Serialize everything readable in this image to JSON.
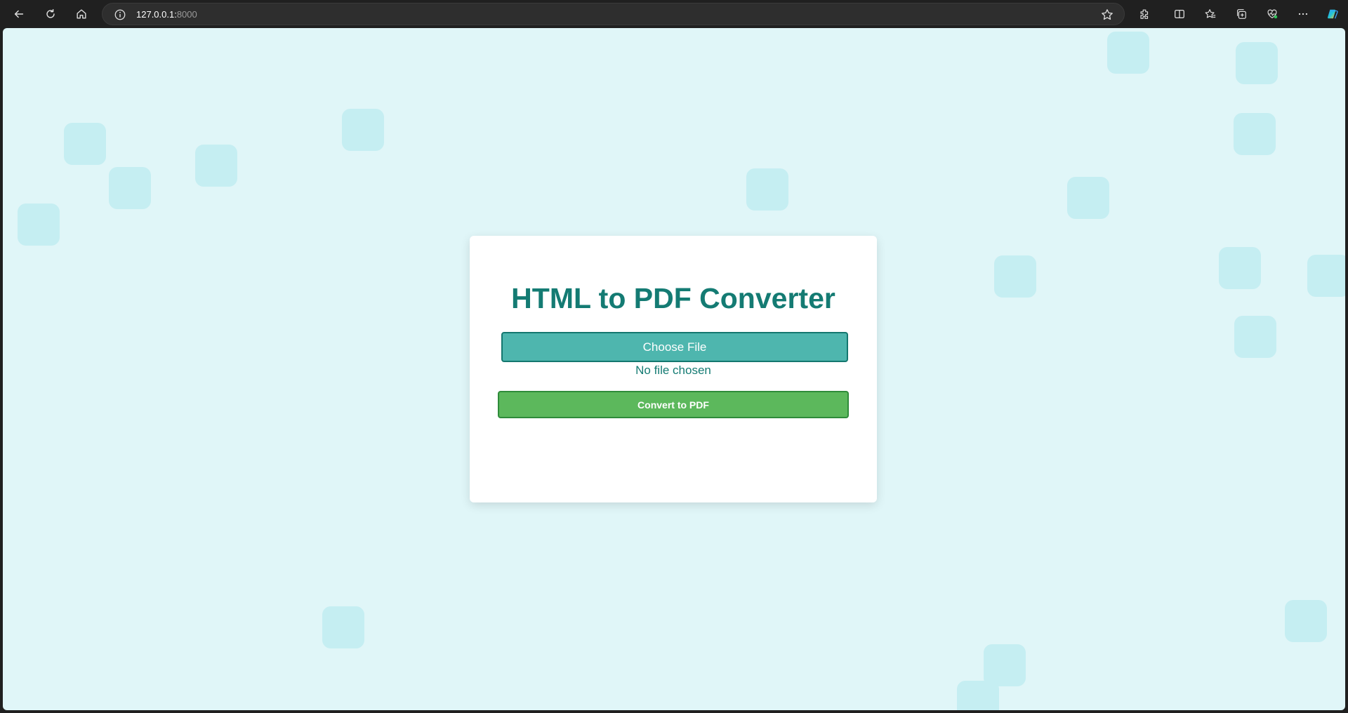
{
  "browser": {
    "url_host": "127.0.0.1:",
    "url_port": "8000",
    "icons": [
      "back-icon",
      "refresh-icon",
      "home-icon",
      "info-icon",
      "star-icon",
      "extensions-icon",
      "split-screen-icon",
      "favorites-icon",
      "collections-icon",
      "health-icon",
      "more-icon",
      "copilot-icon"
    ]
  },
  "main": {
    "title": "HTML to PDF Converter",
    "choose_file_label": "Choose File",
    "file_status": "No file chosen",
    "convert_label": "Convert to PDF"
  },
  "colors": {
    "background": "#e0f6f8",
    "square": "#c5eef2",
    "title": "#147b73",
    "choose_button": "#4eb6ae",
    "convert_button": "#5cb85c"
  }
}
